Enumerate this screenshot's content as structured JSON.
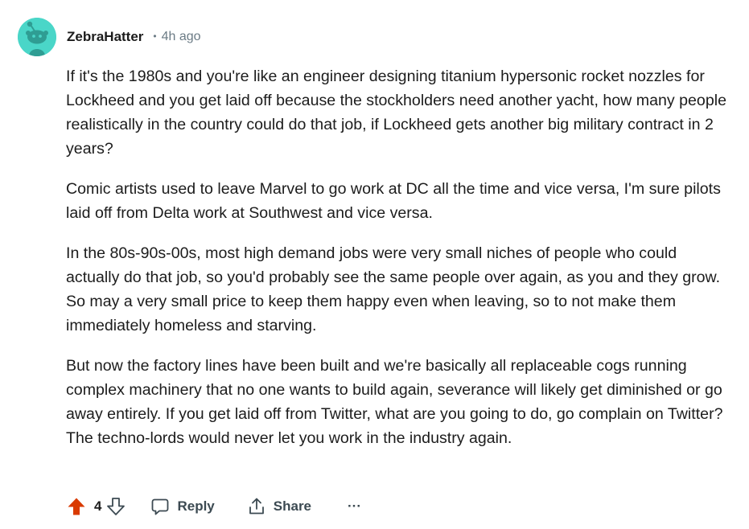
{
  "comment": {
    "author": "ZebraHatter",
    "separator": "•",
    "time": "4h ago",
    "paragraphs": [
      "If it's the 1980s and you're like an engineer designing titanium hypersonic rocket nozzles for Lockheed and you get laid off because the stockholders need another yacht, how many people realistically in the country could do that job, if Lockheed gets another big military contract in 2 years?",
      "Comic artists used to leave Marvel to go work at DC all the time and vice versa, I'm sure pilots laid off from Delta work at Southwest and vice versa.",
      "In the 80s-90s-00s, most high demand jobs were very small niches of people who could actually do that job, so you'd probably see the same people over again, as you and they grow. So may a very small price to keep them happy even when leaving, so to not make them immediately homeless and starving.",
      "But now the factory lines have been built and we're basically all replaceable cogs running complex machinery that no one wants to build again, severance will likely get diminished or go away entirely. If you get laid off from Twitter, what are you going to do, go complain on Twitter? The techno-lords would never let you work in the industry again."
    ]
  },
  "actions": {
    "score": "4",
    "reply_label": "Reply",
    "share_label": "Share",
    "more_label": "···"
  },
  "icons": {
    "avatar": "snoo-avatar-icon",
    "upvote": "upvote-arrow-icon",
    "downvote": "downvote-arrow-icon",
    "reply": "speech-bubble-icon",
    "share": "share-icon",
    "more": "ellipsis-icon"
  },
  "colors": {
    "upvote_active": "#d93a00",
    "avatar_bg": "#4ad6c8",
    "muted": "#6b7b85",
    "text": "#1c1c1c"
  }
}
